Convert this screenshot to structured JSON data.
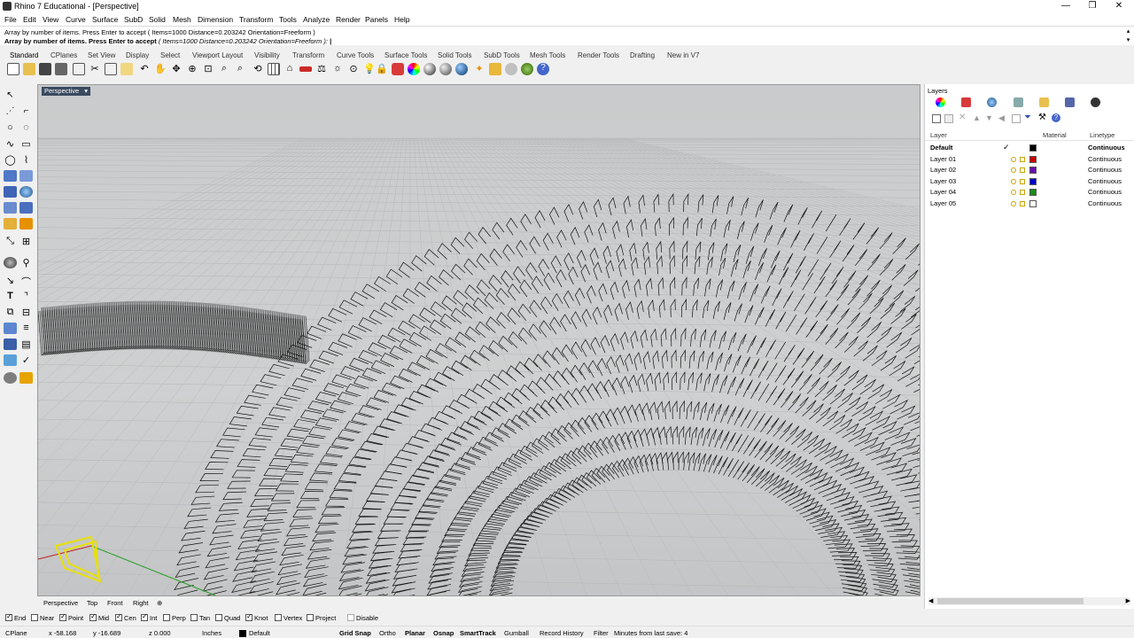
{
  "window": {
    "title": "Rhino 7 Educational - [Perspective]",
    "controls": [
      "—",
      "❐",
      "✕"
    ]
  },
  "menu": [
    "File",
    "Edit",
    "View",
    "Curve",
    "Surface",
    "SubD",
    "Solid",
    "Mesh",
    "Dimension",
    "Transform",
    "Tools",
    "Analyze",
    "Render",
    "Panels",
    "Help"
  ],
  "command": {
    "history": "Array by number of items. Press Enter to accept ( Items=1000  Distance=0.203242  Orientation=Freeform )",
    "prompt": "Array by number of items. Press Enter to accept",
    "options": "( Items=1000  Distance=0.203242  Orientation=Freeform ):"
  },
  "toolbar_tabs": [
    "Standard",
    "CPlanes",
    "Set View",
    "Display",
    "Select",
    "Viewport Layout",
    "Visibility",
    "Transform",
    "Curve Tools",
    "Surface Tools",
    "Solid Tools",
    "SubD Tools",
    "Mesh Tools",
    "Render Tools",
    "Drafting",
    "New in V7"
  ],
  "viewport": {
    "title": "Perspective",
    "dropdown": "▾"
  },
  "view_tabs": [
    "Perspective",
    "Top",
    "Front",
    "Right",
    "⊕"
  ],
  "layers": {
    "panel_title": "Layers",
    "columns": {
      "layer": "Layer",
      "material": "Material",
      "linetype": "Linetype"
    },
    "rows": [
      {
        "name": "Default",
        "current": "✓",
        "color": "#000000",
        "linetype": "Continuous"
      },
      {
        "name": "Layer 01",
        "current": "",
        "color": "#cc0000",
        "linetype": "Continuous"
      },
      {
        "name": "Layer 02",
        "current": "",
        "color": "#6a0dad",
        "linetype": "Continuous"
      },
      {
        "name": "Layer 03",
        "current": "",
        "color": "#0000cc",
        "linetype": "Continuous"
      },
      {
        "name": "Layer 04",
        "current": "",
        "color": "#1a8a1a",
        "linetype": "Continuous"
      },
      {
        "name": "Layer 05",
        "current": "",
        "color": "#ffffff",
        "linetype": "Continuous"
      }
    ]
  },
  "osnaps": [
    {
      "label": "End",
      "on": true
    },
    {
      "label": "Near",
      "on": false
    },
    {
      "label": "Point",
      "on": true
    },
    {
      "label": "Mid",
      "on": true
    },
    {
      "label": "Cen",
      "on": true
    },
    {
      "label": "Int",
      "on": true
    },
    {
      "label": "Perp",
      "on": false
    },
    {
      "label": "Tan",
      "on": false
    },
    {
      "label": "Quad",
      "on": false
    },
    {
      "label": "Knot",
      "on": true
    },
    {
      "label": "Vertex",
      "on": false
    },
    {
      "label": "Project",
      "on": false
    },
    {
      "label": "Disable",
      "on": false
    }
  ],
  "status": {
    "cplane": "CPlane",
    "x": "x -58.168",
    "y": "y -16.689",
    "z": "z 0.000",
    "units": "Inches",
    "layer": "Default",
    "grid_snap": "Grid Snap",
    "ortho": "Ortho",
    "planar": "Planar",
    "osnap": "Osnap",
    "smarttrack": "SmartTrack",
    "gumball": "Gumball",
    "record_history": "Record History",
    "filter": "Filter",
    "save_info": "Minutes from last save: 4"
  }
}
